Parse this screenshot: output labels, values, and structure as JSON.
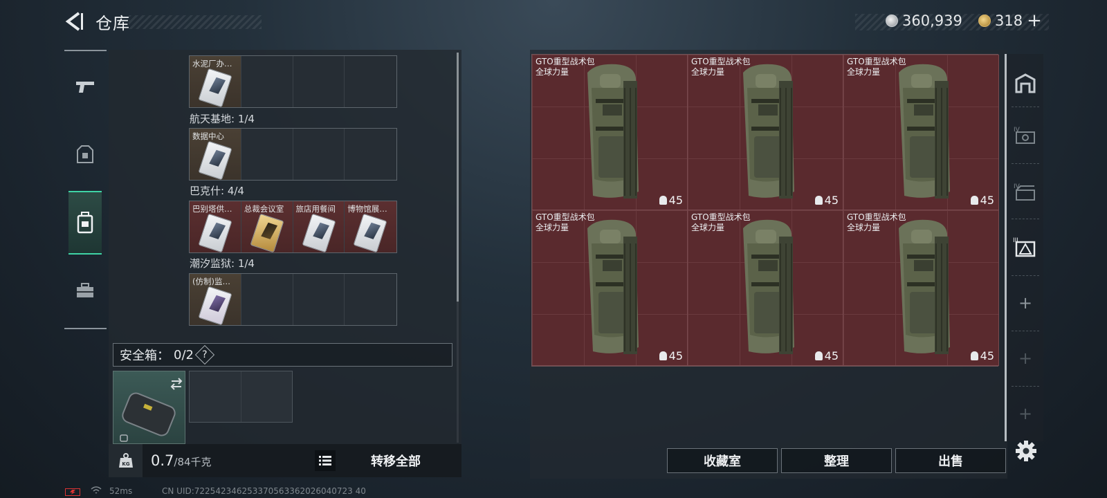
{
  "header": {
    "title": "仓库",
    "currency_primary": "360,939",
    "currency_secondary": "318",
    "plus_label": "+"
  },
  "left_nav": {
    "items": [
      {
        "icon": "gun-icon"
      },
      {
        "icon": "armor-icon"
      },
      {
        "icon": "backpack-icon",
        "active": true
      },
      {
        "icon": "toolbox-icon"
      }
    ],
    "accent_color": "#3fd4a6"
  },
  "key_groups": [
    {
      "label": "",
      "items": [
        "水泥厂办…",
        "",
        "",
        ""
      ]
    },
    {
      "label": "航天基地: 1/4",
      "items": [
        "数据中心",
        "",
        "",
        ""
      ]
    },
    {
      "label": "巴克什: 4/4",
      "items": [
        "巴别塔供…",
        "总裁会议室",
        "旅店用餐间",
        "博物馆展…"
      ]
    },
    {
      "label": "潮汐监狱: 1/4",
      "items": [
        "(仿制)监…",
        "",
        "",
        ""
      ]
    }
  ],
  "safe_box": {
    "label": "安全箱：",
    "count": "0/2",
    "help": "?"
  },
  "bottom_bar": {
    "weight_icon_label": "KG",
    "weight_current": "0.7",
    "weight_max": "/84千克",
    "transfer_label": "转移全部"
  },
  "stash_items": [
    {
      "name": "GTO重型战术包",
      "sub": "全球力量",
      "grade": "45"
    },
    {
      "name": "GTO重型战术包",
      "sub": "全球力量",
      "grade": "45"
    },
    {
      "name": "GTO重型战术包",
      "sub": "全球力量",
      "grade": "45"
    },
    {
      "name": "GTO重型战术包",
      "sub": "全球力量",
      "grade": "45"
    },
    {
      "name": "GTO重型战术包",
      "sub": "全球力量",
      "grade": "45"
    },
    {
      "name": "GTO重型战术包",
      "sub": "全球力量",
      "grade": "45"
    }
  ],
  "actions": {
    "collection": "收藏室",
    "organize": "整理",
    "sell": "出售"
  },
  "status_bar": {
    "ping": "52ms",
    "uid": "CN UID:722542346253370563362026040723 40"
  }
}
